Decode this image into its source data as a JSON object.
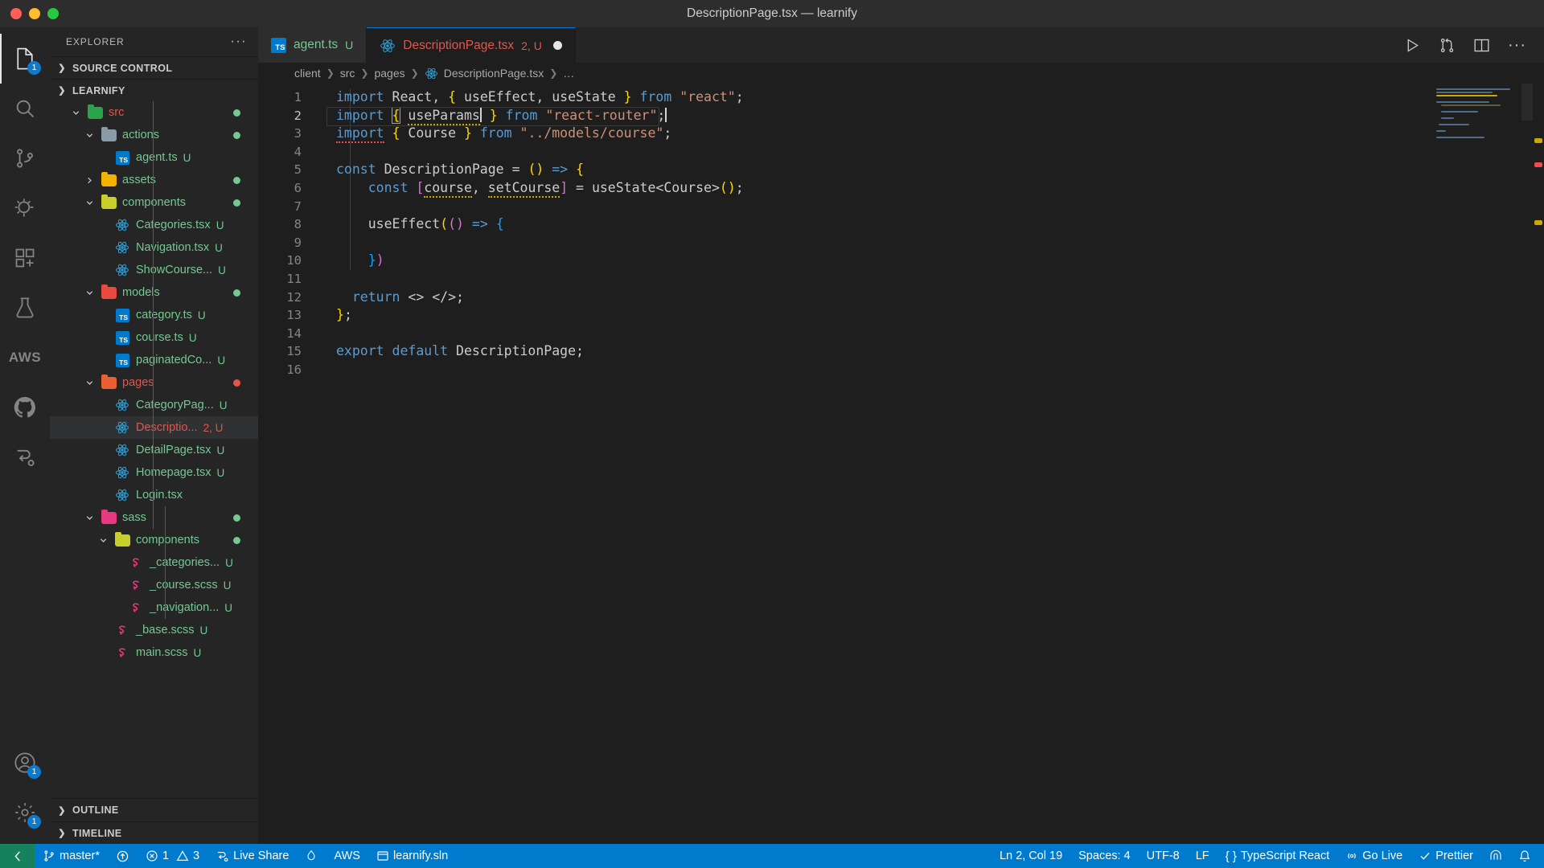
{
  "window": {
    "title": "DescriptionPage.tsx — learnify",
    "traffic_lights": [
      "close",
      "minimize",
      "maximize"
    ]
  },
  "activitybar": {
    "items": [
      {
        "name": "explorer",
        "icon": "files-icon",
        "active": true,
        "badge": "1"
      },
      {
        "name": "search",
        "icon": "search-icon",
        "active": false,
        "badge": ""
      },
      {
        "name": "source-control",
        "icon": "source-control-icon",
        "active": false,
        "badge": ""
      },
      {
        "name": "run-and-debug",
        "icon": "run-debug-icon",
        "active": false,
        "badge": ""
      },
      {
        "name": "extensions",
        "icon": "extensions-icon",
        "active": false,
        "badge": ""
      },
      {
        "name": "test-explorer",
        "icon": "beaker-icon",
        "active": false,
        "badge": ""
      },
      {
        "name": "aws-toolkit",
        "icon": "aws-icon",
        "active": false,
        "badge": ""
      },
      {
        "name": "github",
        "icon": "github-icon",
        "active": false,
        "badge": ""
      },
      {
        "name": "live-share",
        "icon": "live-share-icon",
        "active": false,
        "badge": ""
      }
    ],
    "bottom": [
      {
        "name": "accounts",
        "icon": "account-icon",
        "badge": "1"
      },
      {
        "name": "manage",
        "icon": "gear-icon",
        "badge": "1"
      }
    ]
  },
  "sidebar": {
    "header_title": "EXPLORER",
    "header_more": "···",
    "sections": [
      {
        "label": "SOURCE CONTROL",
        "expanded": false
      },
      {
        "label": "LEARNIFY",
        "expanded": true
      }
    ],
    "bottom_sections": [
      {
        "label": "OUTLINE",
        "expanded": false
      },
      {
        "label": "TIMELINE",
        "expanded": false
      }
    ],
    "tree": [
      {
        "label": "src",
        "depth": 1,
        "kind": "folder",
        "folder": "f-srcgreen",
        "twisty": "down",
        "color": "red",
        "suffix": "",
        "status": "dot"
      },
      {
        "label": "actions",
        "depth": 2,
        "kind": "folder",
        "folder": "f-grey",
        "twisty": "down",
        "color": "green",
        "suffix": "",
        "status": "dot"
      },
      {
        "label": "agent.ts",
        "depth": 3,
        "kind": "ts",
        "folder": "",
        "twisty": "",
        "color": "green",
        "suffix": "U",
        "status": ""
      },
      {
        "label": "assets",
        "depth": 2,
        "kind": "folder",
        "folder": "f-yellow",
        "twisty": "right",
        "color": "green",
        "suffix": "",
        "status": "dot"
      },
      {
        "label": "components",
        "depth": 2,
        "kind": "folder",
        "folder": "f-ylgreen",
        "twisty": "down",
        "color": "green",
        "suffix": "",
        "status": "dot"
      },
      {
        "label": "Categories.tsx",
        "depth": 3,
        "kind": "react",
        "folder": "",
        "twisty": "",
        "color": "green",
        "suffix": "U",
        "status": ""
      },
      {
        "label": "Navigation.tsx",
        "depth": 3,
        "kind": "react",
        "folder": "",
        "twisty": "",
        "color": "green",
        "suffix": "U",
        "status": ""
      },
      {
        "label": "ShowCourse...",
        "depth": 3,
        "kind": "react",
        "folder": "",
        "twisty": "",
        "color": "green",
        "suffix": "U",
        "status": ""
      },
      {
        "label": "models",
        "depth": 2,
        "kind": "folder",
        "folder": "f-red",
        "twisty": "down",
        "color": "green",
        "suffix": "",
        "status": "dot"
      },
      {
        "label": "category.ts",
        "depth": 3,
        "kind": "ts",
        "folder": "",
        "twisty": "",
        "color": "green",
        "suffix": "U",
        "status": ""
      },
      {
        "label": "course.ts",
        "depth": 3,
        "kind": "ts",
        "folder": "",
        "twisty": "",
        "color": "green",
        "suffix": "U",
        "status": ""
      },
      {
        "label": "paginatedCo...",
        "depth": 3,
        "kind": "ts",
        "folder": "",
        "twisty": "",
        "color": "green",
        "suffix": "U",
        "status": ""
      },
      {
        "label": "pages",
        "depth": 2,
        "kind": "folder",
        "folder": "f-orange",
        "twisty": "down",
        "color": "red",
        "suffix": "",
        "status": "dot-red"
      },
      {
        "label": "CategoryPag...",
        "depth": 3,
        "kind": "react",
        "folder": "",
        "twisty": "",
        "color": "green",
        "suffix": "U",
        "status": ""
      },
      {
        "label": "Descriptio...",
        "depth": 3,
        "kind": "react",
        "folder": "",
        "twisty": "",
        "color": "red",
        "suffix": "2, U",
        "status": "",
        "selected": true
      },
      {
        "label": "DetailPage.tsx",
        "depth": 3,
        "kind": "react",
        "folder": "",
        "twisty": "",
        "color": "green",
        "suffix": "U",
        "status": ""
      },
      {
        "label": "Homepage.tsx",
        "depth": 3,
        "kind": "react",
        "folder": "",
        "twisty": "",
        "color": "green",
        "suffix": "U",
        "status": ""
      },
      {
        "label": "Login.tsx",
        "depth": 3,
        "kind": "react",
        "folder": "",
        "twisty": "",
        "color": "green",
        "suffix": "",
        "status": ""
      },
      {
        "label": "sass",
        "depth": 2,
        "kind": "folder",
        "folder": "f-pink",
        "twisty": "down",
        "color": "green",
        "suffix": "",
        "status": "dot"
      },
      {
        "label": "components",
        "depth": 3,
        "kind": "folder",
        "folder": "f-ylgreen",
        "twisty": "down",
        "color": "green",
        "suffix": "",
        "status": "dot"
      },
      {
        "label": "_categories...",
        "depth": 4,
        "kind": "sass",
        "folder": "",
        "twisty": "",
        "color": "green",
        "suffix": "U",
        "status": ""
      },
      {
        "label": "_course.scss",
        "depth": 4,
        "kind": "sass",
        "folder": "",
        "twisty": "",
        "color": "green",
        "suffix": "U",
        "status": ""
      },
      {
        "label": "_navigation...",
        "depth": 4,
        "kind": "sass",
        "folder": "",
        "twisty": "",
        "color": "green",
        "suffix": "U",
        "status": ""
      },
      {
        "label": "_base.scss",
        "depth": 3,
        "kind": "sass",
        "folder": "",
        "twisty": "",
        "color": "green",
        "suffix": "U",
        "status": ""
      },
      {
        "label": "main.scss",
        "depth": 3,
        "kind": "sass",
        "folder": "",
        "twisty": "",
        "color": "green",
        "suffix": "U",
        "status": ""
      }
    ]
  },
  "tabs": [
    {
      "label": "agent.ts",
      "badge": "U",
      "icon": "typescript-icon",
      "active": false,
      "dirty": false
    },
    {
      "label": "DescriptionPage.tsx",
      "badge": "2, U",
      "icon": "react-icon",
      "active": true,
      "dirty": true
    }
  ],
  "tab_actions": [
    {
      "name": "run-button",
      "icon": "play-icon"
    },
    {
      "name": "split-compare-button",
      "icon": "compare-icon"
    },
    {
      "name": "split-editor-button",
      "icon": "split-editor-icon"
    },
    {
      "name": "more-actions-button",
      "icon": "ellipsis-icon"
    }
  ],
  "breadcrumb": [
    "client",
    "src",
    "pages",
    "DescriptionPage.tsx",
    "…"
  ],
  "breadcrumb_file_icon": "react-icon",
  "editor": {
    "language": "TypeScript React",
    "line_count": 16,
    "current_line": 2,
    "lines": [
      {
        "n": 1,
        "text": "import React, { useEffect, useState } from \"react\";"
      },
      {
        "n": 2,
        "text": "import { useParams } from \"react-router\";"
      },
      {
        "n": 3,
        "text": "import { Course } from \"../models/course\";"
      },
      {
        "n": 4,
        "text": ""
      },
      {
        "n": 5,
        "text": "const DescriptionPage = () => {"
      },
      {
        "n": 6,
        "text": "    const [course, setCourse] = useState<Course>();"
      },
      {
        "n": 7,
        "text": ""
      },
      {
        "n": 8,
        "text": "    useEffect(() => {"
      },
      {
        "n": 9,
        "text": ""
      },
      {
        "n": 10,
        "text": "    })"
      },
      {
        "n": 11,
        "text": ""
      },
      {
        "n": 12,
        "text": "  return <> </>;"
      },
      {
        "n": 13,
        "text": "};"
      },
      {
        "n": 14,
        "text": ""
      },
      {
        "n": 15,
        "text": "export default DescriptionPage;"
      },
      {
        "n": 16,
        "text": ""
      }
    ]
  },
  "statusbar": {
    "left": [
      {
        "name": "remote-indicator",
        "icon": "remote-icon",
        "label": ""
      },
      {
        "name": "branch",
        "icon": "source-control-icon",
        "label": "master*"
      },
      {
        "name": "sync-changes",
        "icon": "cloud-upload-icon",
        "label": ""
      },
      {
        "name": "problems",
        "icon": "error-warning-icon",
        "label": "1",
        "label2": "3"
      },
      {
        "name": "live-share",
        "icon": "live-share-icon",
        "label": "Live Share"
      },
      {
        "name": "flame",
        "icon": "flame-icon",
        "label": ""
      },
      {
        "name": "aws",
        "icon": "",
        "label": "AWS"
      },
      {
        "name": "solution",
        "icon": "window-icon",
        "label": "learnify.sln"
      }
    ],
    "right": [
      {
        "name": "cursor-position",
        "icon": "",
        "label": "Ln 2, Col 19"
      },
      {
        "name": "indentation",
        "icon": "",
        "label": "Spaces: 4"
      },
      {
        "name": "encoding",
        "icon": "",
        "label": "UTF-8"
      },
      {
        "name": "eol",
        "icon": "",
        "label": "LF"
      },
      {
        "name": "language-mode",
        "icon": "braces-icon",
        "label": "TypeScript React"
      },
      {
        "name": "go-live",
        "icon": "broadcast-icon",
        "label": "Go Live"
      },
      {
        "name": "prettier",
        "icon": "check-icon",
        "label": "Prettier"
      },
      {
        "name": "remote-tunnel",
        "icon": "tunnel-icon",
        "label": ""
      },
      {
        "name": "notifications",
        "icon": "bell-icon",
        "label": ""
      }
    ],
    "problems_errors": "1",
    "problems_warnings": "3"
  },
  "colors": {
    "accent": "#007acc",
    "remote_green": "#16825d",
    "file_green": "#73c991",
    "file_red": "#e2574c",
    "editor_bg": "#1e1e1e",
    "sidebar_bg": "#252526"
  }
}
